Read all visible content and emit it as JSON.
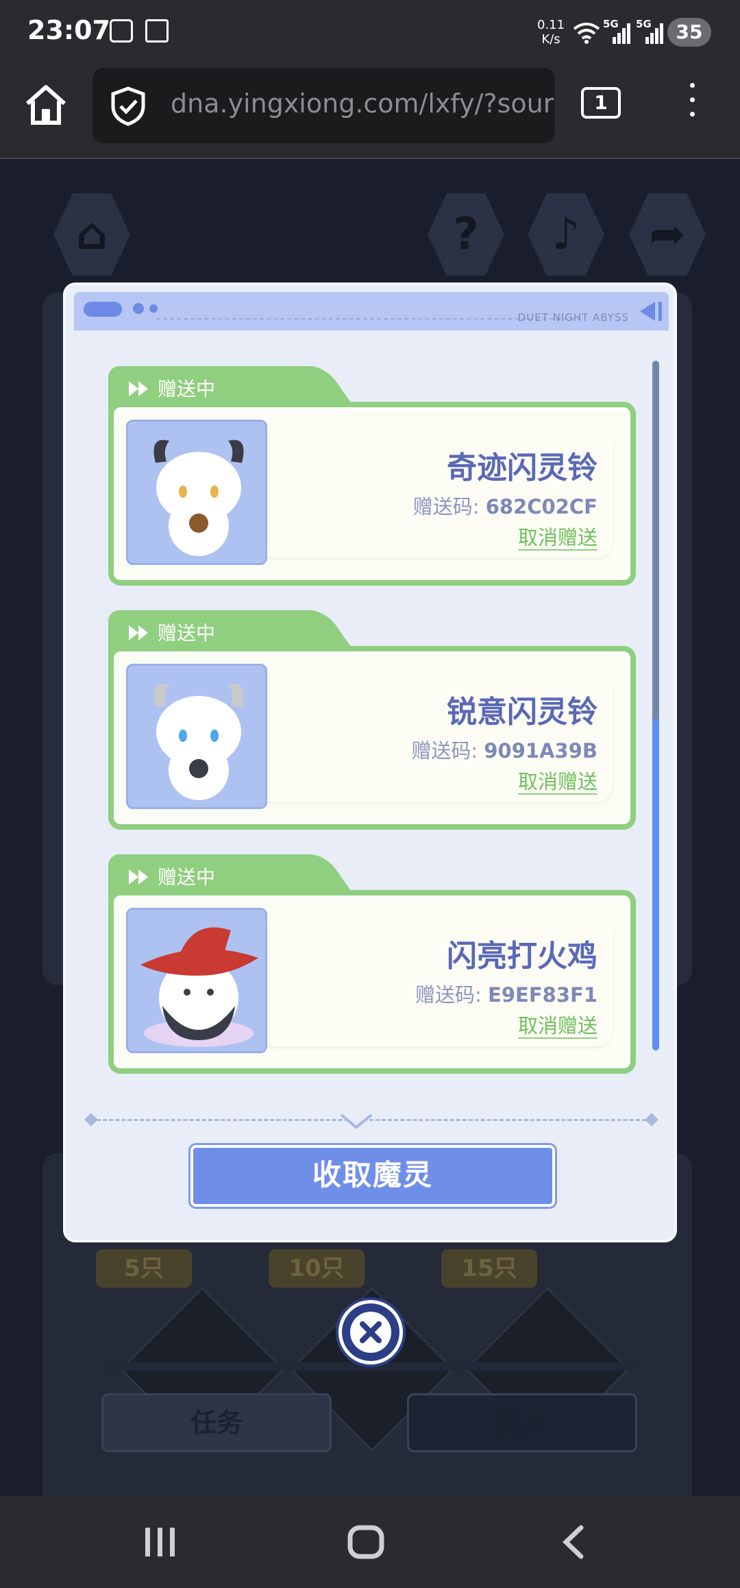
{
  "status_bar": {
    "time": "23:07",
    "net_speed_value": "0.11",
    "net_speed_unit": "K/s",
    "sim1": "5G",
    "sim2": "5G",
    "battery": "35"
  },
  "browser": {
    "url": "dna.yingxiong.com/lxfy/?sour",
    "tab_count": "1"
  },
  "background": {
    "tier_badges": [
      "5只",
      "10只",
      "15只"
    ],
    "tabs": [
      "任务",
      "魔灵"
    ]
  },
  "dialog": {
    "brand": "DUET NIGHT ABYSS",
    "items": [
      {
        "status": "赠送中",
        "name": "奇迹闪灵铃",
        "code_label": "赠送码:",
        "code": "682C02CF",
        "cancel": "取消赠送"
      },
      {
        "status": "赠送中",
        "name": "锐意闪灵铃",
        "code_label": "赠送码:",
        "code": "9091A39B",
        "cancel": "取消赠送"
      },
      {
        "status": "赠送中",
        "name": "闪亮打火鸡",
        "code_label": "赠送码:",
        "code": "E9EF83F1",
        "cancel": "取消赠送"
      }
    ],
    "collect_button": "收取魔灵"
  }
}
